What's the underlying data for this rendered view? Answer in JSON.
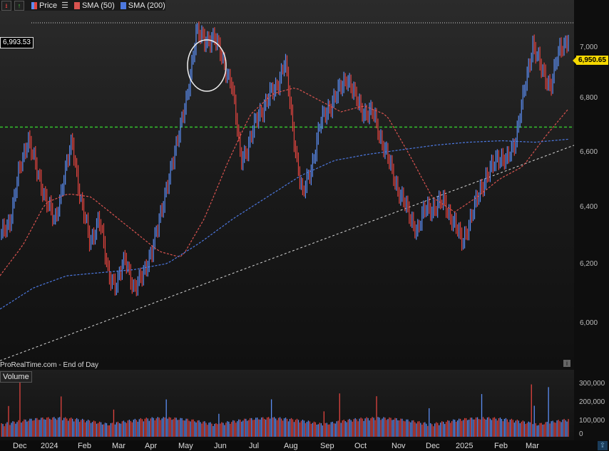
{
  "legend": {
    "price_label": "Price",
    "sma50_label": "SMA (50)",
    "sma200_label": "SMA (200)"
  },
  "volume_legend_label": "Volume",
  "source_label": "ProRealTime.com - End of Day",
  "high_marker": "6,993.53",
  "last_price": "6,950.65",
  "price_axis_labels": [
    "7,000",
    "6,800",
    "6,600",
    "6,400",
    "6,200",
    "6,000"
  ],
  "volume_axis_labels": [
    "300,000",
    "200,000",
    "100,000",
    "0"
  ],
  "time_axis_labels": [
    "Dec",
    "2024",
    "Feb",
    "Mar",
    "Apr",
    "May",
    "Jun",
    "Jul",
    "Aug",
    "Sep",
    "Oct",
    "Nov",
    "Dec",
    "2025",
    "Feb",
    "Mar"
  ],
  "colors": {
    "up": "#5b8df2",
    "down": "#e0443f",
    "sma50": "#d9534f",
    "sma200": "#4c78e0",
    "support": "#35c12d",
    "last_price_tag": "#f5d800"
  },
  "support_level": 6650,
  "chart_data": {
    "type": "ohlc",
    "series": [
      {
        "name": "Price",
        "values": [
          6290,
          6350,
          6500,
          6620,
          6500,
          6420,
          6330,
          6480,
          6600,
          6400,
          6270,
          6350,
          6180,
          6120,
          6230,
          6100,
          6180,
          6230,
          6380,
          6480,
          6640,
          6740,
          6980,
          6920,
          6960,
          6860,
          6800,
          6540,
          6600,
          6690,
          6740,
          6780,
          6870,
          6620,
          6420,
          6520,
          6660,
          6720,
          6760,
          6820,
          6740,
          6700,
          6690,
          6600,
          6510,
          6430,
          6360,
          6310,
          6390,
          6380,
          6410,
          6330,
          6280,
          6340,
          6450,
          6490,
          6560,
          6530,
          6610,
          6760,
          6930,
          6830,
          6790,
          6900,
          6950
        ]
      },
      {
        "name": "SMA (50)",
        "values": [
          6160,
          6260,
          6400,
          6430,
          6420,
          6360,
          6300,
          6240,
          6220,
          6350,
          6530,
          6690,
          6760,
          6780,
          6740,
          6700,
          6720,
          6690,
          6560,
          6420,
          6370,
          6420,
          6480,
          6520,
          6620,
          6710
        ]
      },
      {
        "name": "SMA (200)",
        "values": [
          6050,
          6120,
          6160,
          6170,
          6180,
          6200,
          6270,
          6350,
          6420,
          6490,
          6540,
          6560,
          6575,
          6590,
          6600,
          6605,
          6600,
          6610
        ]
      }
    ],
    "volume_max": 300000,
    "ylim": [
      5850,
      7050
    ]
  }
}
